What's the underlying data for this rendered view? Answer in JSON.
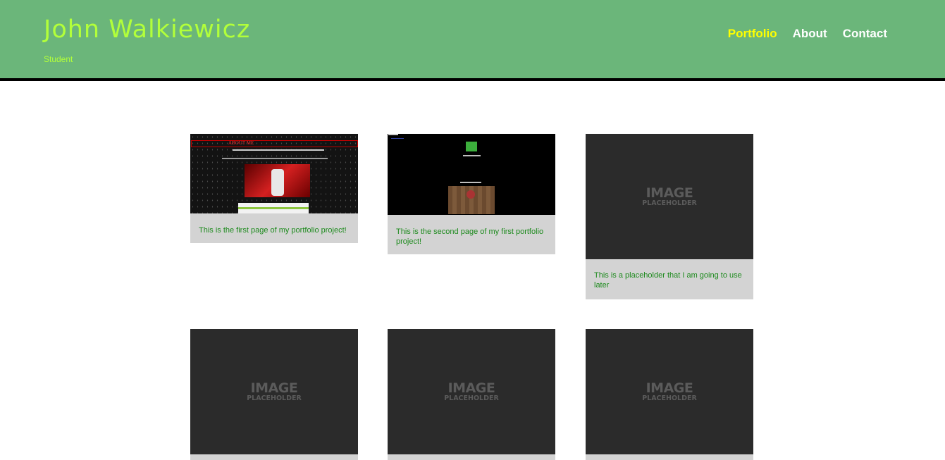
{
  "header": {
    "title": "John Walkiewicz",
    "subtitle": "Student"
  },
  "nav": {
    "items": [
      {
        "label": "Portfolio",
        "active": true
      },
      {
        "label": "About",
        "active": false
      },
      {
        "label": "Contact",
        "active": false
      }
    ]
  },
  "colors": {
    "header_bg": "#6bb67a",
    "title": "#b2ff3a",
    "nav_active": "#ffff00",
    "caption_text": "#1d8a1d",
    "card_bg": "#d3d3d3"
  },
  "placeholder": {
    "big": "IMAGE",
    "small": "PLACEHOLDER"
  },
  "cards": [
    {
      "caption": "This is the first page of my portfolio project!",
      "image": "portfolio-screenshot-1"
    },
    {
      "caption": "This is the second page of my first portfolio project!",
      "image": "portfolio-screenshot-2"
    },
    {
      "caption": "This is a placeholder that I am going to use later",
      "image": "image-placeholder"
    },
    {
      "caption": "",
      "image": "image-placeholder"
    },
    {
      "caption": "",
      "image": "image-placeholder"
    },
    {
      "caption": "",
      "image": "image-placeholder"
    }
  ],
  "thumb_text": {
    "shot1_banner": "ABOUT ME"
  }
}
